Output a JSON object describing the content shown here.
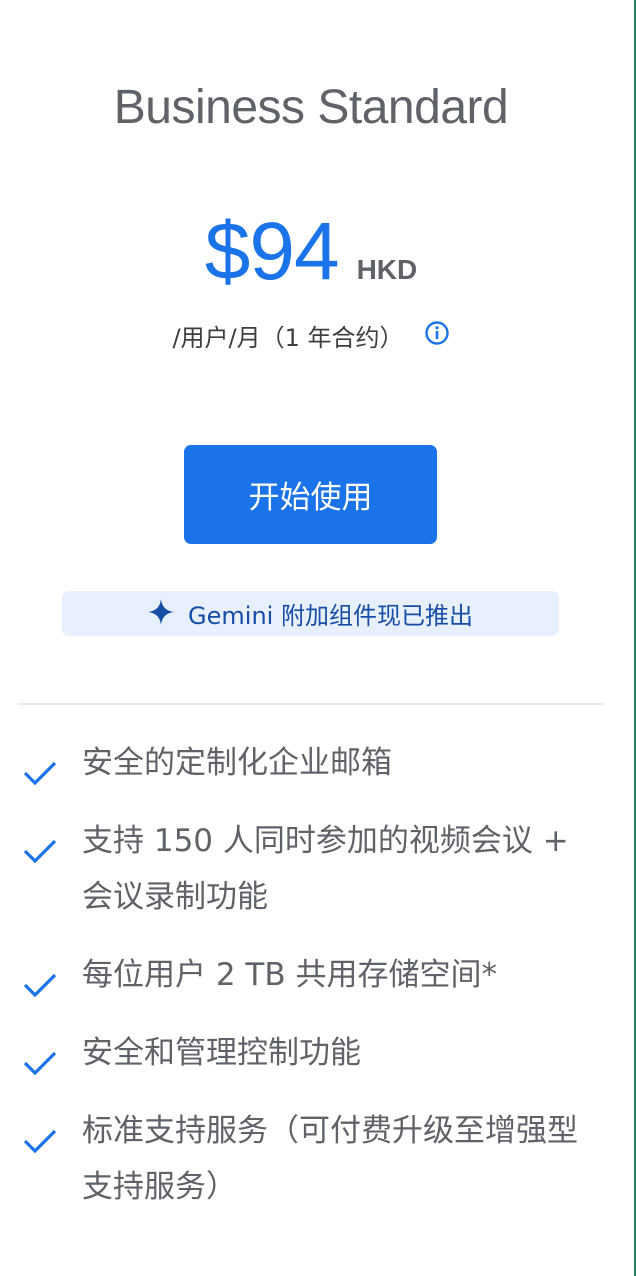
{
  "plan": {
    "title": "Business Standard",
    "price_amount": "$94",
    "price_currency": "HKD",
    "price_term": "/用户/月（1 年合约）",
    "info_icon": "info-icon"
  },
  "cta": {
    "label": "开始使用"
  },
  "gemini_banner": {
    "icon": "sparkle-icon",
    "label": "Gemini 附加组件现已推出"
  },
  "features": [
    {
      "icon": "check-icon",
      "text": "安全的定制化企业邮箱"
    },
    {
      "icon": "check-icon",
      "text": "支持 150 人同时参加的视频会议 + 会议录制功能"
    },
    {
      "icon": "check-icon",
      "text": "每位用户 2 TB 共用存储空间*"
    },
    {
      "icon": "check-icon",
      "text": "安全和管理控制功能"
    },
    {
      "icon": "check-icon",
      "text": "标准支持服务（可付费升级至增强型支持服务）"
    }
  ],
  "colors": {
    "accent": "#1a73e8",
    "title_gray": "#5f6368",
    "banner_bg": "#e8f0fe",
    "banner_text": "#174ea6",
    "edge": "#2e7d62"
  }
}
